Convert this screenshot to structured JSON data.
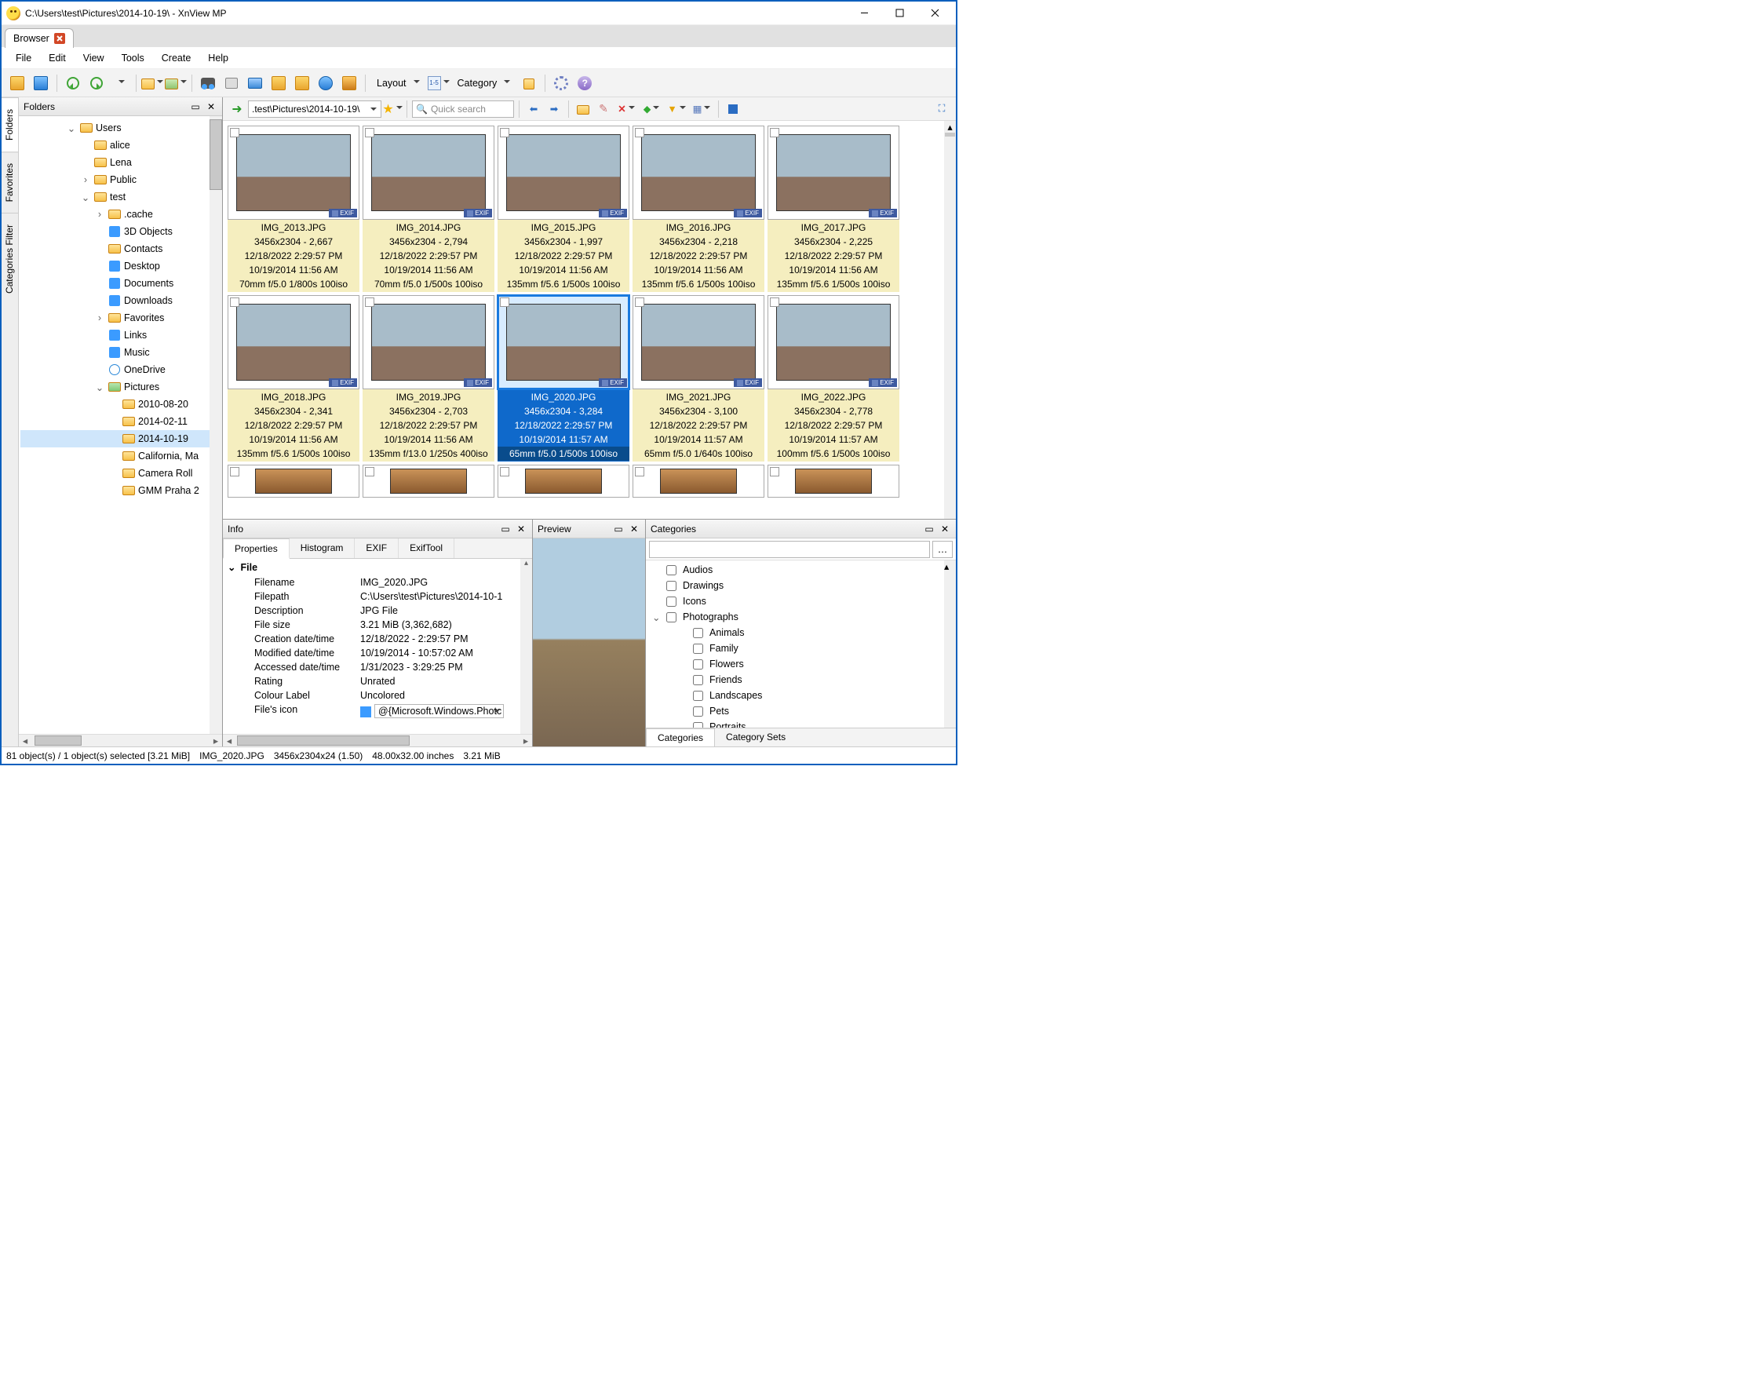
{
  "title": "C:\\Users\\test\\Pictures\\2014-10-19\\ - XnView MP",
  "browserTab": "Browser",
  "menu": [
    "File",
    "Edit",
    "View",
    "Tools",
    "Create",
    "Help"
  ],
  "layoutLabel": "Layout",
  "categoryLabel": "Category",
  "toolbar2": {
    "path": ".test\\Pictures\\2014-10-19\\",
    "searchPlaceholder": "Quick search"
  },
  "leftTabs": [
    "Folders",
    "Favorites",
    "Categories Filter"
  ],
  "foldersPaneTitle": "Folders",
  "tree": {
    "users": "Users",
    "alice": "alice",
    "lena": "Lena",
    "public": "Public",
    "test": "test",
    "cache": ".cache",
    "threeD": "3D Objects",
    "contacts": "Contacts",
    "desktop": "Desktop",
    "documents": "Documents",
    "downloads": "Downloads",
    "favorites": "Favorites",
    "links": "Links",
    "music": "Music",
    "onedrive": "OneDrive",
    "pictures": "Pictures",
    "d2010": "2010-08-20",
    "d2014a": "2014-02-11",
    "d2014b": "2014-10-19",
    "california": "California, Ma",
    "camroll": "Camera Roll",
    "gmm": "GMM Praha 2"
  },
  "thumbs": [
    {
      "name": "IMG_2013.JPG",
      "dim": "3456x2304 - 2,667",
      "mod": "12/18/2022 2:29:57 PM",
      "taken": "10/19/2014 11:56 AM",
      "exif": "70mm f/5.0 1/800s 100iso"
    },
    {
      "name": "IMG_2014.JPG",
      "dim": "3456x2304 - 2,794",
      "mod": "12/18/2022 2:29:57 PM",
      "taken": "10/19/2014 11:56 AM",
      "exif": "70mm f/5.0 1/500s 100iso"
    },
    {
      "name": "IMG_2015.JPG",
      "dim": "3456x2304 - 1,997",
      "mod": "12/18/2022 2:29:57 PM",
      "taken": "10/19/2014 11:56 AM",
      "exif": "135mm f/5.6 1/500s 100iso"
    },
    {
      "name": "IMG_2016.JPG",
      "dim": "3456x2304 - 2,218",
      "mod": "12/18/2022 2:29:57 PM",
      "taken": "10/19/2014 11:56 AM",
      "exif": "135mm f/5.6 1/500s 100iso"
    },
    {
      "name": "IMG_2017.JPG",
      "dim": "3456x2304 - 2,225",
      "mod": "12/18/2022 2:29:57 PM",
      "taken": "10/19/2014 11:56 AM",
      "exif": "135mm f/5.6 1/500s 100iso"
    },
    {
      "name": "IMG_2018.JPG",
      "dim": "3456x2304 - 2,341",
      "mod": "12/18/2022 2:29:57 PM",
      "taken": "10/19/2014 11:56 AM",
      "exif": "135mm f/5.6 1/500s 100iso"
    },
    {
      "name": "IMG_2019.JPG",
      "dim": "3456x2304 - 2,703",
      "mod": "12/18/2022 2:29:57 PM",
      "taken": "10/19/2014 11:56 AM",
      "exif": "135mm f/13.0 1/250s 400iso"
    },
    {
      "name": "IMG_2020.JPG",
      "dim": "3456x2304 - 3,284",
      "mod": "12/18/2022 2:29:57 PM",
      "taken": "10/19/2014 11:57 AM",
      "exif": "65mm f/5.0 1/500s 100iso",
      "sel": true
    },
    {
      "name": "IMG_2021.JPG",
      "dim": "3456x2304 - 3,100",
      "mod": "12/18/2022 2:29:57 PM",
      "taken": "10/19/2014 11:57 AM",
      "exif": "65mm f/5.0 1/640s 100iso"
    },
    {
      "name": "IMG_2022.JPG",
      "dim": "3456x2304 - 2,778",
      "mod": "12/18/2022 2:29:57 PM",
      "taken": "10/19/2014 11:57 AM",
      "exif": "100mm f/5.6 1/500s 100iso"
    }
  ],
  "exifBadge": "EXIF",
  "info": {
    "title": "Info",
    "tabs": [
      "Properties",
      "Histogram",
      "EXIF",
      "ExifTool"
    ],
    "group": "File",
    "rows": [
      {
        "k": "Filename",
        "v": "IMG_2020.JPG"
      },
      {
        "k": "Filepath",
        "v": "C:\\Users\\test\\Pictures\\2014-10-1"
      },
      {
        "k": "Description",
        "v": "JPG File"
      },
      {
        "k": "File size",
        "v": "3.21 MiB (3,362,682)"
      },
      {
        "k": "Creation date/time",
        "v": "12/18/2022 - 2:29:57 PM"
      },
      {
        "k": "Modified date/time",
        "v": "10/19/2014 - 10:57:02 AM"
      },
      {
        "k": "Accessed date/time",
        "v": "1/31/2023 - 3:29:25 PM"
      },
      {
        "k": "Rating",
        "v": "Unrated"
      },
      {
        "k": "Colour Label",
        "v": "Uncolored"
      }
    ],
    "iconRow": {
      "k": "File's icon",
      "v": "@{Microsoft.Windows.Photc"
    }
  },
  "previewTitle": "Preview",
  "categoriesTitle": "Categories",
  "catTabs": [
    "Categories",
    "Category Sets"
  ],
  "categories": [
    {
      "name": "Audios",
      "exp": false
    },
    {
      "name": "Drawings",
      "exp": false
    },
    {
      "name": "Icons",
      "exp": false
    },
    {
      "name": "Photographs",
      "exp": true,
      "children": [
        "Animals",
        "Family",
        "Flowers",
        "Friends",
        "Landscapes",
        "Pets",
        "Portraits"
      ]
    }
  ],
  "status": {
    "count": "81 object(s) / 1 object(s) selected [3.21 MiB]",
    "file": "IMG_2020.JPG",
    "dim": "3456x2304x24 (1.50)",
    "inches": "48.00x32.00 inches",
    "size": "3.21 MiB"
  }
}
